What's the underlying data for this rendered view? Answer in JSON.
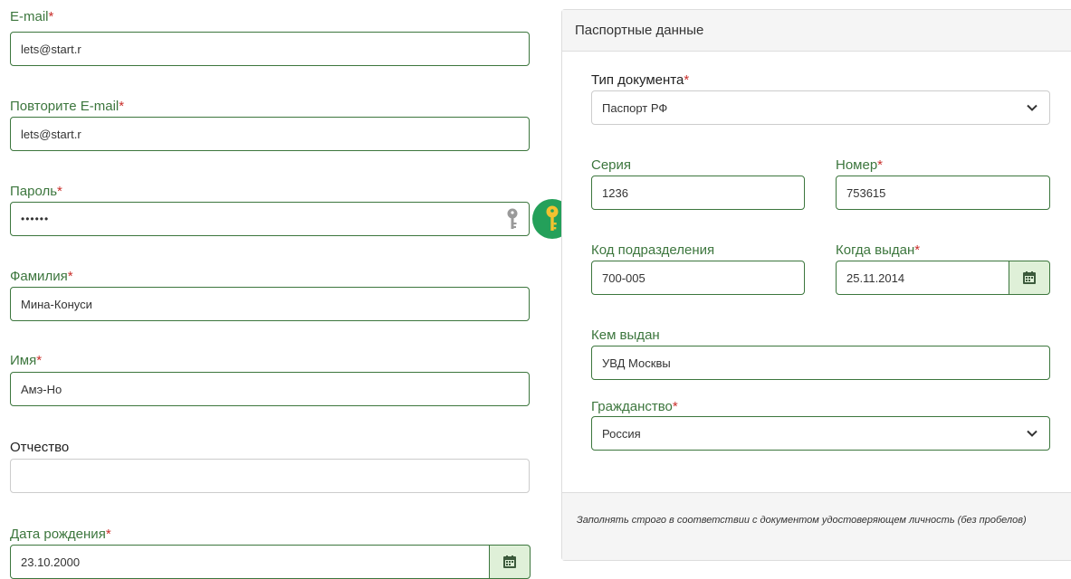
{
  "left_form": {
    "email": {
      "label": "E-mail",
      "required_mark": "*",
      "value": "lets@start.r"
    },
    "email_repeat": {
      "label": "Повторите E-mail",
      "required_mark": "*",
      "value": "lets@start.r"
    },
    "password": {
      "label": "Пароль",
      "required_mark": "*",
      "value": "••••••"
    },
    "last_name": {
      "label": "Фамилия",
      "required_mark": "*",
      "value": "Мина-Конуси"
    },
    "first_name": {
      "label": "Имя",
      "required_mark": "*",
      "value": "Амэ-Но"
    },
    "patronymic": {
      "label": "Отчество",
      "value": ""
    },
    "birth_date": {
      "label": "Дата рождения",
      "required_mark": "*",
      "value": "23.10.2000"
    }
  },
  "passport_panel": {
    "title": "Паспортные данные",
    "doc_type": {
      "label": "Тип документа",
      "required_mark": "*",
      "selected": "Паспорт РФ"
    },
    "series": {
      "label": "Серия",
      "value": "1236"
    },
    "number": {
      "label": "Номер",
      "required_mark": "*",
      "value": "753615"
    },
    "dept_code": {
      "label": "Код подразделения",
      "value": "700-005"
    },
    "issue_date": {
      "label": "Когда выдан",
      "required_mark": "*",
      "value": "25.11.2014"
    },
    "issued_by": {
      "label": "Кем выдан",
      "value": "УВД Москвы"
    },
    "citizenship": {
      "label": "Гражданство",
      "required_mark": "*",
      "selected": "Россия"
    },
    "footer_note": "Заполнять строго в соответствии с документом удостоверяющем личность (без пробелов)"
  },
  "icons": {
    "password_key": "key-icon",
    "generate_password": "key-icon",
    "calendar": "calendar-icon",
    "select_arrow": "chevron-down-icon"
  },
  "colors": {
    "valid_green": "#3c763d",
    "required_red": "#c9302c",
    "addon_bg": "#dff0d8",
    "key_button_bg": "#24a05a",
    "key_color": "#f2c230"
  }
}
